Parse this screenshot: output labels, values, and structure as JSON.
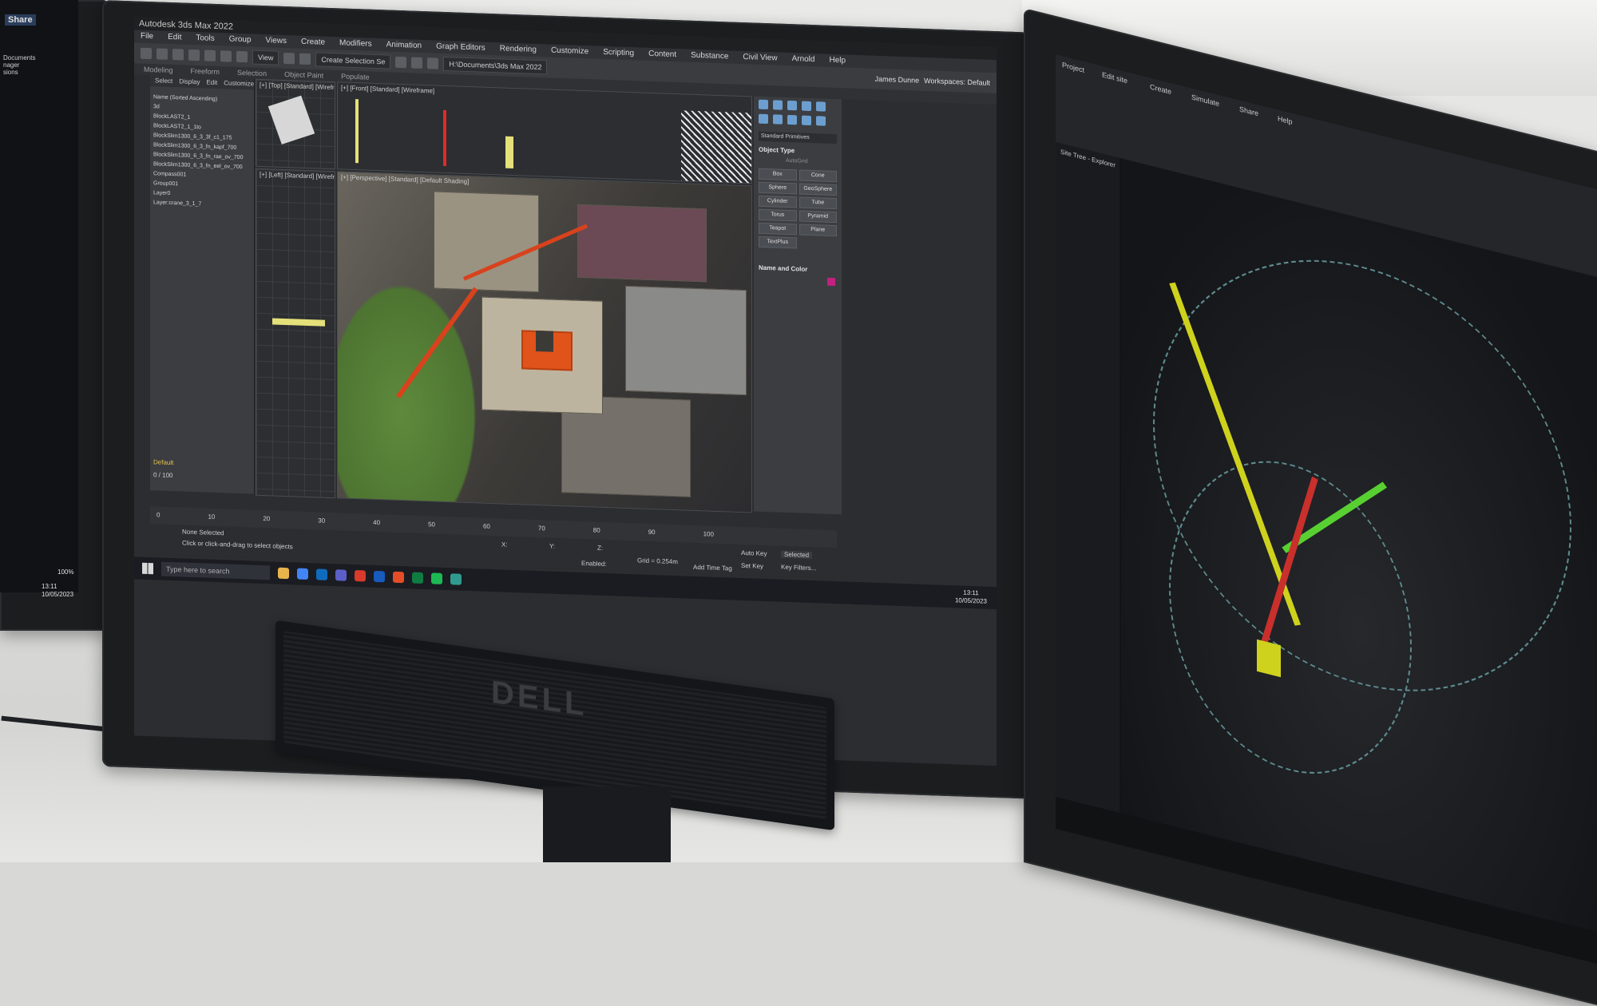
{
  "center": {
    "title_bar": "Autodesk 3ds Max 2022",
    "menu": [
      "File",
      "Edit",
      "Tools",
      "Group",
      "Views",
      "Create",
      "Modifiers",
      "Animation",
      "Graph Editors",
      "Rendering",
      "Customize",
      "Scripting",
      "Content",
      "Substance",
      "Civil View",
      "Arnold",
      "Help"
    ],
    "toolbar": {
      "view_dropdown": "View",
      "create_selection": "Create Selection Se",
      "path": "H:\\Documents\\3ds Max 2022",
      "user": "James Dunne",
      "workspace": "Workspaces: Default"
    },
    "ribbon_tabs": [
      "Modeling",
      "Freeform",
      "Selection",
      "Object Paint",
      "Populate"
    ],
    "explorer": {
      "tabs": [
        "Select",
        "Display",
        "Edit",
        "Customize"
      ],
      "header": "Name (Sorted Ascending)",
      "rows": [
        "3d",
        "BlockLAST2_1",
        "BlockLAST2_1_1to",
        "BlockSlim1300_6_3_3f_c1_175",
        "BlockSlim1300_6_3_fn_kapf_700",
        "BlockSlim1300_6_3_fn_rae_ov_700",
        "BlockSlim1300_6_3_fn_eel_ov_700",
        "Compass001",
        "Group001",
        "Layer0",
        "Layer:crane_3_1_7"
      ],
      "layer_default": "Default",
      "frame_counter": "0 / 100"
    },
    "viewports": {
      "top": "[+] [Top] [Standard] [Wireframe]",
      "front": "[+] [Front] [Standard] [Wireframe]",
      "left": "[+] [Left] [Standard] [Wireframe]",
      "perspective": "[+] [Perspective] [Standard] [Default Shading]"
    },
    "command_panel": {
      "dropdown": "Standard Primitives",
      "object_type": "Object Type",
      "autogrid": "AutoGrid",
      "buttons": [
        "Box",
        "Cone",
        "Sphere",
        "GeoSphere",
        "Cylinder",
        "Tube",
        "Torus",
        "Pyramid",
        "Teapot",
        "Plane",
        "TextPlus"
      ],
      "name_and_color": "Name and Color",
      "swatch_color": "#c2217f"
    },
    "timeline_ticks": [
      "0",
      "10",
      "20",
      "30",
      "40",
      "50",
      "60",
      "70",
      "80",
      "90",
      "100"
    ],
    "status": {
      "line1": "None Selected",
      "line2": "Click or click-and-drag to select objects",
      "x": "X:",
      "y": "Y:",
      "z": "Z:",
      "grid": "Grid = 0.254m",
      "enabled": "Enabled:",
      "add_time_tag": "Add Time Tag",
      "auto_key": "Auto Key",
      "selected": "Selected",
      "set_key": "Set Key",
      "key_filters": "Key Filters..."
    },
    "taskbar": {
      "search": "Type here to search",
      "time": "13:11",
      "date": "10/05/2023"
    }
  },
  "left": {
    "share": "Share",
    "docs": [
      "Documents",
      "nager",
      "sions"
    ],
    "zoom": "100%",
    "time": "13:11",
    "date": "10/05/2023"
  },
  "right": {
    "tabs": [
      "Project",
      "Edit site",
      "Create",
      "Simulate",
      "Share",
      "Help"
    ],
    "sidebar_title": "Site Tree - Explorer"
  },
  "monitor_brand": "DELL",
  "colors": {
    "crane_yellow": "#cfd21c",
    "crane_green": "#58d031",
    "crane_red": "#c9302b",
    "model_orange": "#e0531b"
  }
}
